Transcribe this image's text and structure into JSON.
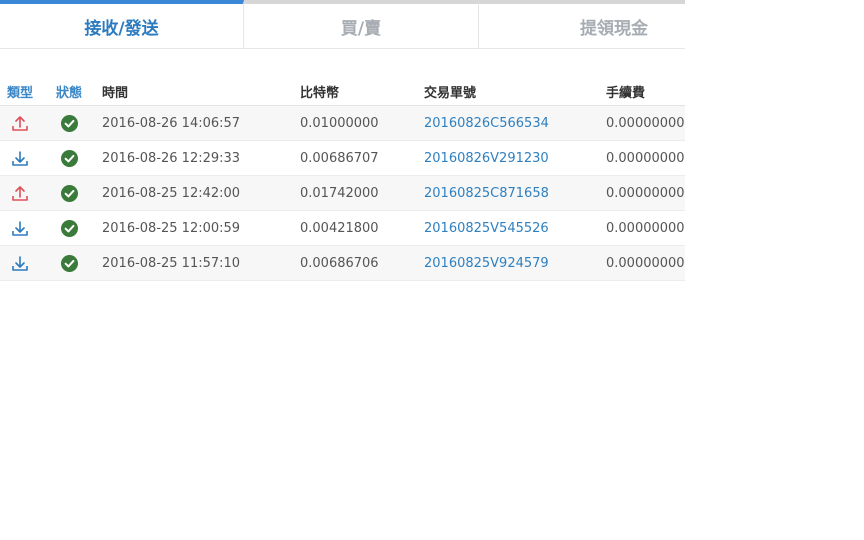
{
  "tabs": [
    "接收/發送",
    "買/賣",
    "提領現金"
  ],
  "columns": {
    "type": "類型",
    "status": "狀態",
    "time": "時間",
    "btc": "比特幣",
    "txid": "交易單號",
    "fee": "手續費"
  },
  "colors": {
    "send": "#e0505a",
    "receive": "#2c7bbf",
    "check": "#3a7a3a",
    "link": "#2f80c0"
  },
  "rows": [
    {
      "type_icon": "upload-icon",
      "status_icon": "check-circle-icon",
      "time": "2016-08-26 14:06:57",
      "btc": "0.01000000",
      "txid": "20160826C566534",
      "fee": "0.00000000"
    },
    {
      "type_icon": "download-icon",
      "status_icon": "check-circle-icon",
      "time": "2016-08-26 12:29:33",
      "btc": "0.00686707",
      "txid": "20160826V291230",
      "fee": "0.00000000"
    },
    {
      "type_icon": "upload-icon",
      "status_icon": "check-circle-icon",
      "time": "2016-08-25 12:42:00",
      "btc": "0.01742000",
      "txid": "20160825C871658",
      "fee": "0.00000000"
    },
    {
      "type_icon": "download-icon",
      "status_icon": "check-circle-icon",
      "time": "2016-08-25 12:00:59",
      "btc": "0.00421800",
      "txid": "20160825V545526",
      "fee": "0.00000000"
    },
    {
      "type_icon": "download-icon",
      "status_icon": "check-circle-icon",
      "time": "2016-08-25 11:57:10",
      "btc": "0.00686706",
      "txid": "20160825V924579",
      "fee": "0.00000000"
    }
  ]
}
